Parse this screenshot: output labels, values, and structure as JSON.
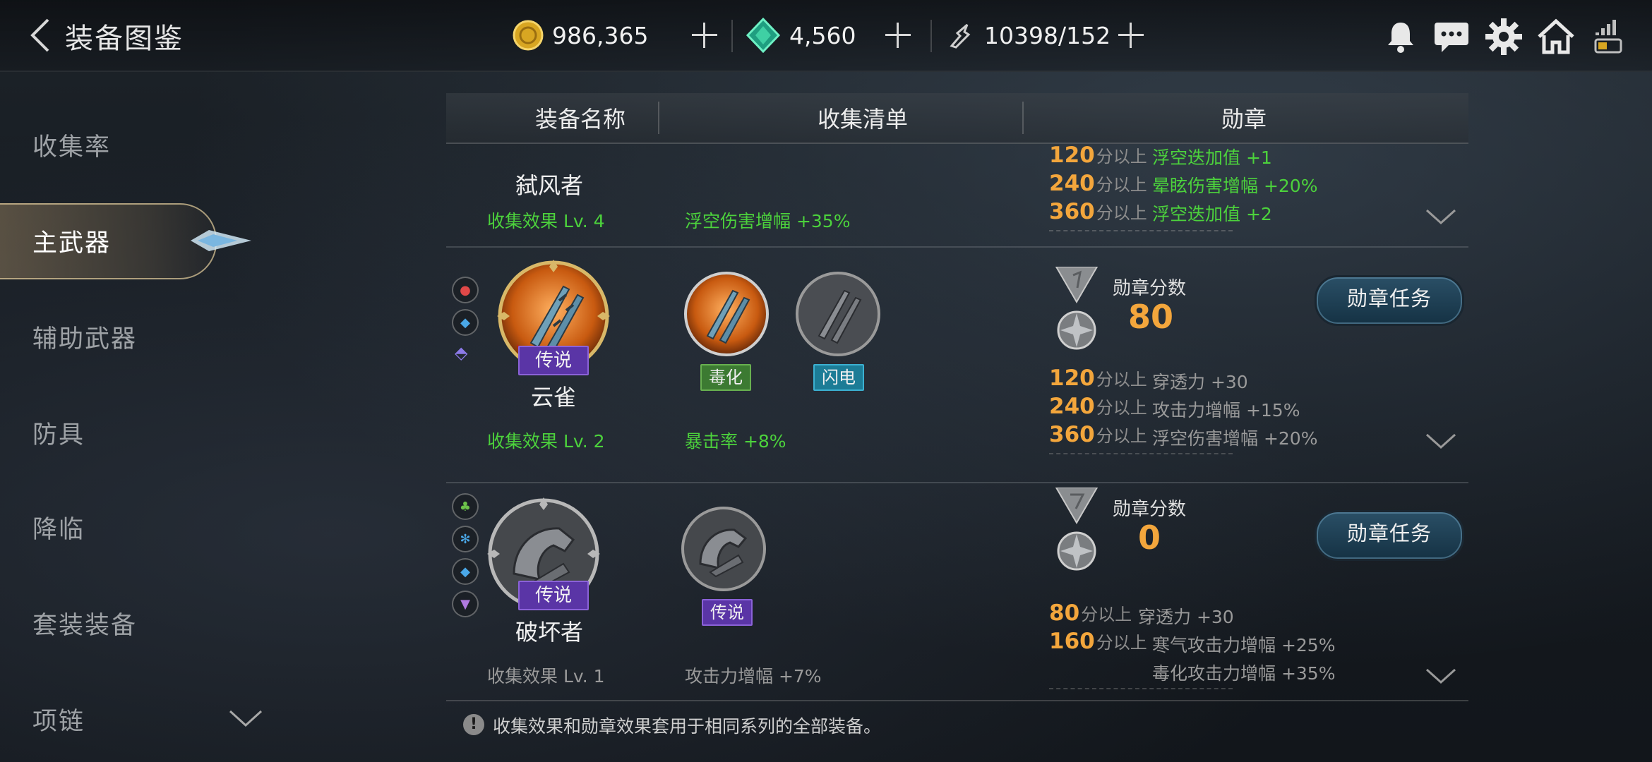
{
  "header": {
    "title": "装备图鉴",
    "gold": "986,365",
    "gems": "4,560",
    "stamina": "10398/152"
  },
  "sidebar": {
    "items": [
      {
        "label": "收集率"
      },
      {
        "label": "主武器",
        "active": true
      },
      {
        "label": "辅助武器"
      },
      {
        "label": "防具"
      },
      {
        "label": "降临"
      },
      {
        "label": "套装装备"
      },
      {
        "label": "项链"
      }
    ]
  },
  "table": {
    "columns": [
      "装备名称",
      "收集清单",
      "勋章"
    ]
  },
  "rows": [
    {
      "name": "弑风者",
      "collect_level": "收集效果  Lv. 4",
      "collect_effect": "浮空伤害增幅  +35%",
      "tiers": [
        {
          "points": "120",
          "suffix": "分以上",
          "effect": "浮空迭加值  +1"
        },
        {
          "points": "240",
          "suffix": "分以上",
          "effect": "晕眩伤害增幅  +20%"
        },
        {
          "points": "360",
          "suffix": "分以上",
          "effect": "浮空迭加值  +2"
        }
      ]
    },
    {
      "name": "云雀",
      "grade": "传说",
      "collect_level": "收集效果  Lv. 2",
      "collect_effect": "暴击率  +8%",
      "list_tags": [
        "毒化",
        "闪电"
      ],
      "medal_label": "勋章分数",
      "medal_score": "80",
      "quest_button": "勋章任务",
      "tiers": [
        {
          "points": "120",
          "suffix": "分以上",
          "effect": "穿透力  +30"
        },
        {
          "points": "240",
          "suffix": "分以上",
          "effect": "攻击力增幅  +15%"
        },
        {
          "points": "360",
          "suffix": "分以上",
          "effect": "浮空伤害增幅  +20%"
        }
      ]
    },
    {
      "name": "破坏者",
      "grade": "传说",
      "collect_level": "收集效果  Lv. 1",
      "collect_effect": "攻击力增幅  +7%",
      "list_tags": [
        "传说"
      ],
      "medal_label": "勋章分数",
      "medal_score": "0",
      "quest_button": "勋章任务",
      "tiers": [
        {
          "points": "80",
          "suffix": "分以上",
          "effect": "穿透力  +30"
        },
        {
          "points": "160",
          "suffix": "分以上",
          "effect": "寒气攻击力增幅  +25%"
        },
        {
          "points": "",
          "suffix": "",
          "effect": "毒化攻击力增幅  +35%"
        }
      ]
    }
  ],
  "footer": {
    "note": "收集效果和勋章效果套用于相同系列的全部装备。"
  },
  "colors": {
    "active_green": "#4cd23c",
    "inactive_gray": "#9a9a9a",
    "score_orange": "#f3a63c",
    "legend_purple": "#5a35a6"
  }
}
